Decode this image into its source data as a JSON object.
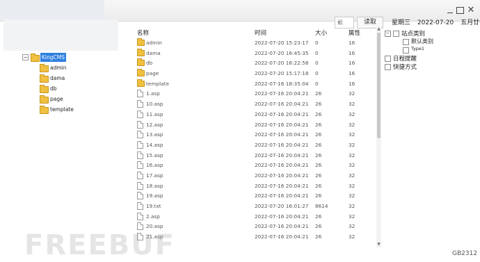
{
  "toolbar": {
    "encoding_select": "混",
    "read_label": "读取",
    "weekday": "星期三",
    "date": "2022-07-20",
    "lunar": "五月廿一"
  },
  "tree": {
    "root": "KingCMS",
    "children": [
      "admin",
      "dama",
      "db",
      "page",
      "template"
    ]
  },
  "filelist": {
    "columns": {
      "name": "名称",
      "time": "时间",
      "size": "大小",
      "attr": "属性"
    },
    "rows": [
      {
        "type": "folder",
        "name": "admin",
        "time": "2022-07-20 15:23:17",
        "size": "0",
        "attr": "16"
      },
      {
        "type": "folder",
        "name": "dama",
        "time": "2022-07-20 16:45:35",
        "size": "0",
        "attr": "16"
      },
      {
        "type": "folder",
        "name": "db",
        "time": "2022-07-20 16:22:58",
        "size": "0",
        "attr": "16"
      },
      {
        "type": "folder",
        "name": "page",
        "time": "2022-07-20 15:17:18",
        "size": "0",
        "attr": "16"
      },
      {
        "type": "folder",
        "name": "template",
        "time": "2022-07-16 18:35:04",
        "size": "0",
        "attr": "16"
      },
      {
        "type": "file",
        "name": "1.asp",
        "time": "2022-07-16 20:04:21",
        "size": "26",
        "attr": "32"
      },
      {
        "type": "file",
        "name": "10.asp",
        "time": "2022-07-16 20:04:21",
        "size": "26",
        "attr": "32"
      },
      {
        "type": "file",
        "name": "11.asp",
        "time": "2022-07-16 20:04:21",
        "size": "26",
        "attr": "32"
      },
      {
        "type": "file",
        "name": "12.asp",
        "time": "2022-07-16 20:04:21",
        "size": "26",
        "attr": "32"
      },
      {
        "type": "file",
        "name": "13.asp",
        "time": "2022-07-16 20:04:21",
        "size": "26",
        "attr": "32"
      },
      {
        "type": "file",
        "name": "14.asp",
        "time": "2022-07-16 20:04:21",
        "size": "26",
        "attr": "32"
      },
      {
        "type": "file",
        "name": "15.asp",
        "time": "2022-07-16 20:04:21",
        "size": "26",
        "attr": "32"
      },
      {
        "type": "file",
        "name": "16.asp",
        "time": "2022-07-16 20:04:21",
        "size": "26",
        "attr": "32"
      },
      {
        "type": "file",
        "name": "17.asp",
        "time": "2022-07-16 20:04:21",
        "size": "26",
        "attr": "32"
      },
      {
        "type": "file",
        "name": "18.asp",
        "time": "2022-07-16 20:04:21",
        "size": "26",
        "attr": "32"
      },
      {
        "type": "file",
        "name": "19.asp",
        "time": "2022-07-16 20:04:21",
        "size": "26",
        "attr": "32"
      },
      {
        "type": "file",
        "name": "19.txt",
        "time": "2022-07-20 16:01:27",
        "size": "8614",
        "attr": "32"
      },
      {
        "type": "file",
        "name": "2.asp",
        "time": "2022-07-16 20:04:21",
        "size": "26",
        "attr": "32"
      },
      {
        "type": "file",
        "name": "20.asp",
        "time": "2022-07-16 20:04:21",
        "size": "26",
        "attr": "32"
      },
      {
        "type": "file",
        "name": "21.asp",
        "time": "2022-07-16 20:04:21",
        "size": "26",
        "attr": "32"
      }
    ]
  },
  "categories": {
    "site_category": "站点类别",
    "default_category": "默认类别",
    "type1": "Type1",
    "schedule_reminder": "日程提醒",
    "shortcut": "快捷方式"
  },
  "watermark": "FREEBUF",
  "corner_label": "GB2312",
  "icons": [
    "minimize-icon",
    "maximize-icon",
    "close-icon",
    "folder-icon",
    "file-icon",
    "chevron-down-icon"
  ]
}
